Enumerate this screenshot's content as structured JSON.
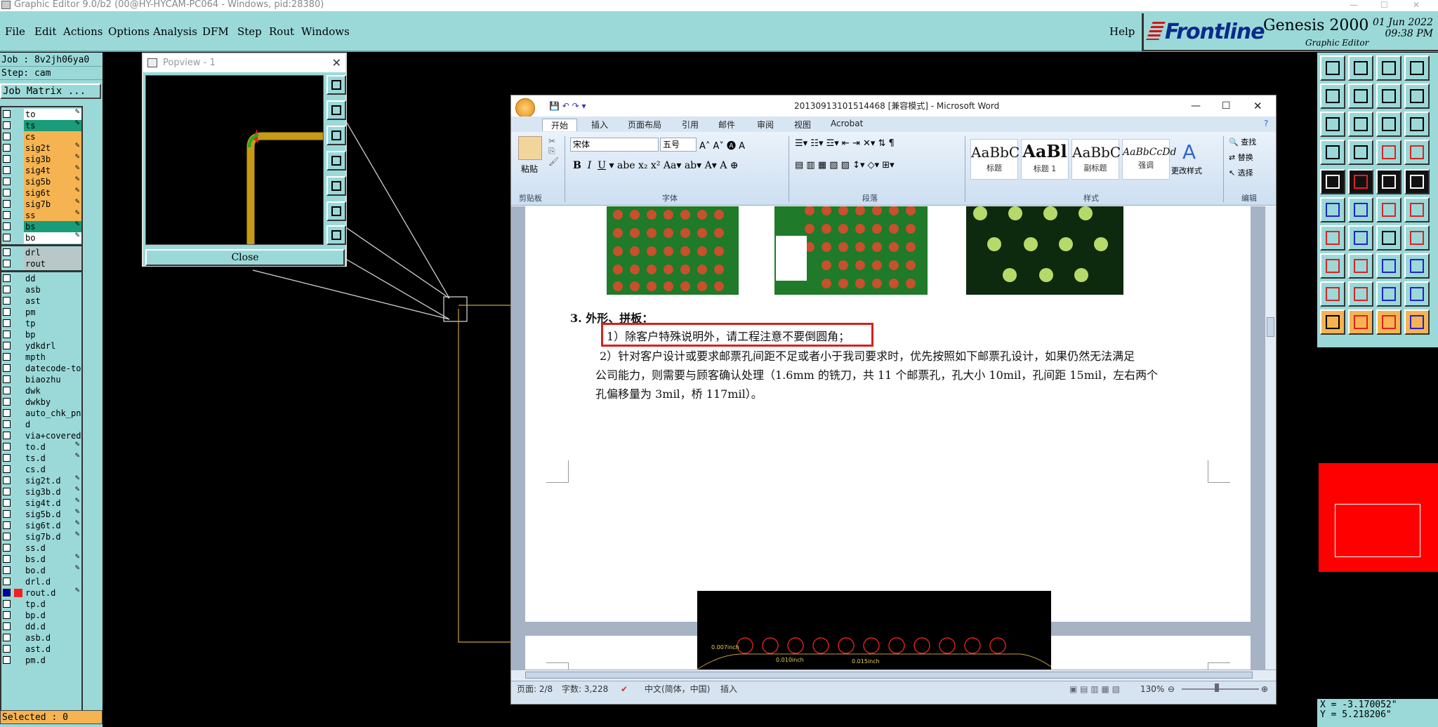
{
  "window_title": "Graphic Editor 9.0/b2 (00@HY-HYCAM-PC064 - Windows, pid:28380)",
  "menu": [
    "File",
    "Edit",
    "Actions",
    "Options",
    "Analysis",
    "DFM",
    "Step",
    "Rout",
    "Windows"
  ],
  "help": "Help",
  "brand": {
    "logo": "Frontline",
    "product": "Genesis 2000",
    "subtitle": "Graphic Editor",
    "date": "01 Jun 2022",
    "time": "09:38 PM"
  },
  "job": {
    "job_label": "Job : 8v2jh06ya0",
    "step_label": "Step: cam",
    "matrix_button": "Job Matrix ..."
  },
  "layers_group1": [
    {
      "name": "to",
      "color": "#ffffff",
      "edit": true
    },
    {
      "name": "ts",
      "color": "#1a9c7a",
      "edit": true
    },
    {
      "name": "cs",
      "color": "#f5b451",
      "edit": false
    },
    {
      "name": "sig2t",
      "color": "#f5b451",
      "edit": true
    },
    {
      "name": "sig3b",
      "color": "#f5b451",
      "edit": true
    },
    {
      "name": "sig4t",
      "color": "#f5b451",
      "edit": true
    },
    {
      "name": "sig5b",
      "color": "#f5b451",
      "edit": true
    },
    {
      "name": "sig6t",
      "color": "#f5b451",
      "edit": true
    },
    {
      "name": "sig7b",
      "color": "#f5b451",
      "edit": true
    },
    {
      "name": "ss",
      "color": "#f5b451",
      "edit": true
    },
    {
      "name": "bs",
      "color": "#1a9c7a",
      "edit": true
    },
    {
      "name": "bo",
      "color": "#ffffff",
      "edit": true
    }
  ],
  "layers_group2": [
    {
      "name": "drl",
      "color": "#b8c8c8"
    },
    {
      "name": "rout",
      "color": "#b8c8c8"
    }
  ],
  "layers_group3": [
    "dd",
    "asb",
    "ast",
    "pm",
    "tp",
    "bp",
    "ydkdrl",
    "mpth",
    "datecode-to",
    "biaozhu",
    "dwk",
    "dwkby",
    "auto_chk_pn",
    "d",
    "via+covered",
    "to.d",
    "ts.d",
    "cs.d",
    "sig2t.d",
    "sig3b.d",
    "sig4t.d",
    "sig5b.d",
    "sig6t.d",
    "sig7b.d",
    "ss.d",
    "bs.d",
    "bo.d",
    "drl.d",
    "rout.d",
    "tp.d",
    "bp.d",
    "dd.d",
    "asb.d",
    "ast.d",
    "pm.d"
  ],
  "layers_group3_edit": [
    "to.d",
    "ts.d",
    "sig2t.d",
    "sig3b.d",
    "sig4t.d",
    "sig5b.d",
    "sig6t.d",
    "sig7b.d",
    "bs.d",
    "bo.d",
    "rout.d"
  ],
  "selected": "Selected : 0",
  "popview": {
    "title": "Popview - 1",
    "close": "Close"
  },
  "word": {
    "title": "20130913101514468 [兼容模式] - Microsoft Word",
    "tabs": [
      "开始",
      "插入",
      "页面布局",
      "引用",
      "邮件",
      "审阅",
      "视图",
      "Acrobat"
    ],
    "font_name": "宋体",
    "font_size": "五号",
    "groups": [
      "剪贴板",
      "字体",
      "段落",
      "样式",
      "编辑"
    ],
    "paste": "粘贴",
    "styles": [
      {
        "sample": "AaBbC",
        "label": "标题"
      },
      {
        "sample": "AaBl",
        "label": "标题 1"
      },
      {
        "sample": "AaBbC",
        "label": "副标题"
      },
      {
        "sample": "AaBbCcDd",
        "label": "强调"
      }
    ],
    "change_styles": "更改样式",
    "edit_items": [
      "查找",
      "替换",
      "选择"
    ],
    "heading": "3.   外形、拼板：",
    "line1": "1）除客户特殊说明外，请工程注意不要倒圆角；",
    "line2": "2）针对客户设计或要求邮票孔间距不足或者小于我司要求时，优先按照如下邮票孔设计，如果仍然无法满足",
    "line3": "公司能力，则需要与顾客确认处理（1.6mm 的铣刀，共 11 个邮票孔，孔大小 10mil，孔间距 15mil，左右两个",
    "line4": "孔偏移量为 3mil，桥 117mil）。",
    "img_labels": [
      "0.007inch",
      "0.010inch",
      "0.015inch"
    ],
    "status": {
      "page": "页面: 2/8",
      "words": "字数: 3,228",
      "lang": "中文(简体，中国)",
      "mode": "插入",
      "zoom": "130%"
    }
  },
  "coords": {
    "x": "X = -3.170052\"",
    "y": "Y = 5.218206\""
  }
}
